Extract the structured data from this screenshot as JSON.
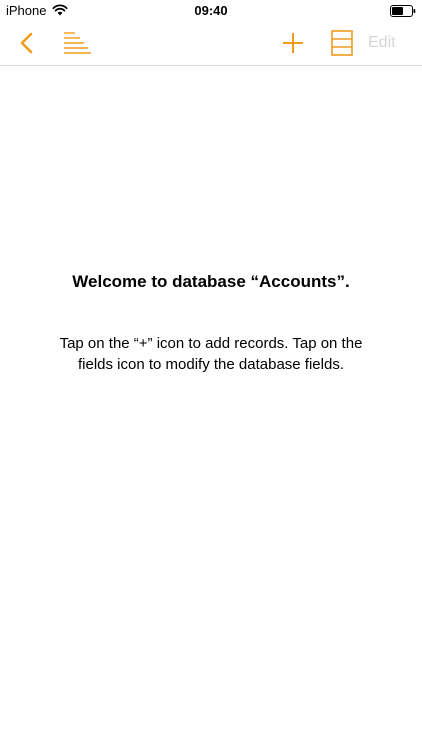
{
  "status_bar": {
    "carrier": "iPhone",
    "time": "09:40"
  },
  "nav_bar": {
    "edit_label": "Edit",
    "accent_color": "#F29B1D",
    "disabled_color": "#D6D6D6"
  },
  "icons": {
    "back": "chevron-left-icon",
    "list": "list-icon",
    "add": "plus-icon",
    "fields": "fields-icon"
  },
  "content": {
    "title": "Welcome to database “Accounts”.",
    "body": "Tap on the “+” icon to add records. Tap on the fields icon to modify the database fields."
  }
}
